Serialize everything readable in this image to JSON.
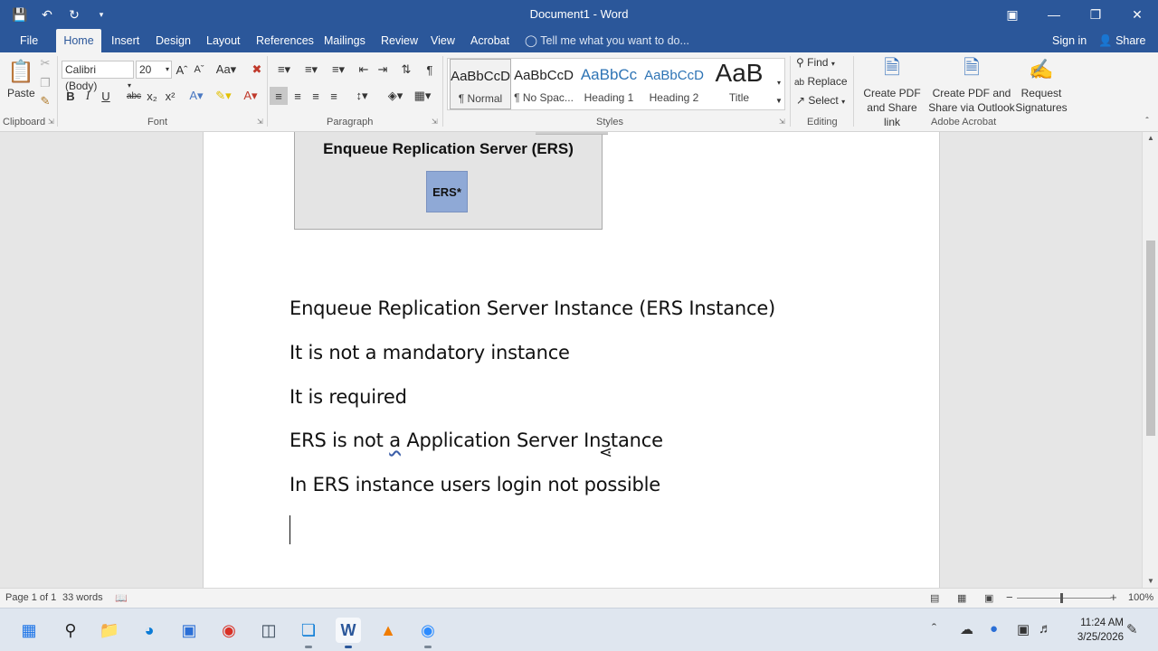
{
  "window": {
    "title": "Document1 - Word",
    "qat": [
      "save-icon",
      "undo-icon",
      "redo-icon",
      "customize-icon"
    ]
  },
  "tabs": [
    "File",
    "Home",
    "Insert",
    "Design",
    "Layout",
    "References",
    "Mailings",
    "Review",
    "View",
    "Acrobat"
  ],
  "active_tab": "Home",
  "tell_me": "Tell me what you want to do...",
  "sign_in": "Sign in",
  "share": "Share",
  "ribbon": {
    "clipboard": {
      "paste": "Paste",
      "label": "Clipboard"
    },
    "font": {
      "name": "Calibri (Body)",
      "size": "20",
      "label": "Font",
      "bold": "B",
      "italic": "I",
      "underline": "U",
      "strike": "abc",
      "sub": "x₂",
      "sup": "x²"
    },
    "paragraph": {
      "label": "Paragraph"
    },
    "styles": {
      "label": "Styles",
      "items": [
        {
          "preview": "AaBbCcD",
          "name": "¶ Normal"
        },
        {
          "preview": "AaBbCcD",
          "name": "¶ No Spac..."
        },
        {
          "preview": "AaBbCc",
          "name": "Heading 1"
        },
        {
          "preview": "AaBbCcD",
          "name": "Heading 2"
        },
        {
          "preview": "AaB",
          "name": "Title"
        }
      ]
    },
    "editing": {
      "label": "Editing",
      "find": "Find",
      "replace": "Replace",
      "select": "Select"
    },
    "acrobat": {
      "label": "Adobe Acrobat",
      "create_pdf_1": "Create PDF",
      "create_pdf_2": "and Share link",
      "create_outlook_1": "Create PDF and",
      "create_outlook_2": "Share via Outlook",
      "request_1": "Request",
      "request_2": "Signatures"
    }
  },
  "document": {
    "figure": {
      "title": "Enqueue Replication Server (ERS)",
      "box": "ERS*"
    },
    "paragraphs": [
      "Enqueue Replication Server Instance (ERS Instance)",
      "It is not a mandatory instance",
      "It is required",
      "ERS is not a Application Server Instance",
      "In ERS instance users login not possible"
    ],
    "p4_parts": [
      "ERS is not ",
      "a",
      " Application Server Instance"
    ]
  },
  "status": {
    "page": "Page 1 of 1",
    "words": "33 words",
    "zoom": "100%"
  },
  "taskbar": {
    "time": "11:24 AM",
    "date": "3/25/2026",
    "apps": [
      "windows-start-icon",
      "search-icon",
      "file-explorer-icon",
      "edge-icon",
      "store-icon",
      "chrome-icon",
      "app-icon",
      "remote-app-icon",
      "word-icon",
      "vlc-icon",
      "zoom-icon"
    ]
  },
  "colors": {
    "word_blue": "#2b579a",
    "ribbon_bg": "#f3f3f3",
    "page_bg": "#ffffff"
  }
}
